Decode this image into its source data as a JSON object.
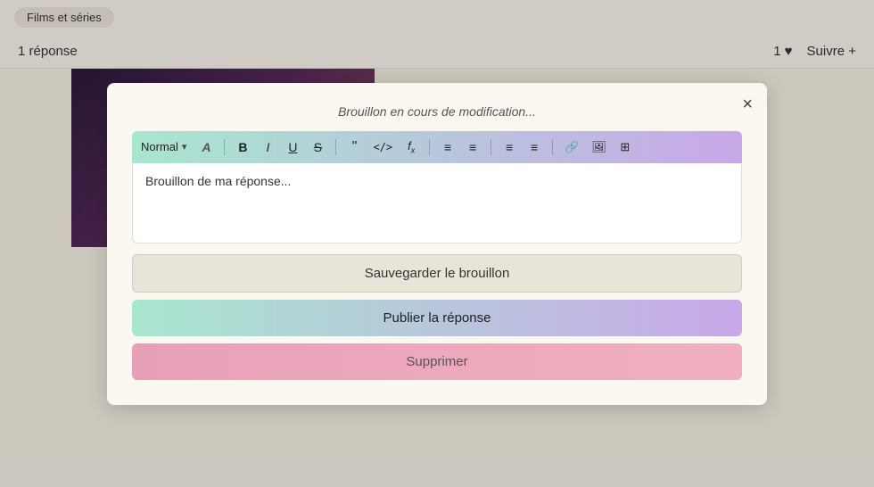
{
  "page": {
    "tag": "Films et séries",
    "replies_count": "1 réponse",
    "likes_count": "1",
    "follow_label": "Suivre +",
    "heart_symbol": "♥"
  },
  "modal": {
    "title": "Brouillon en cours de modification...",
    "close_symbol": "×",
    "toolbar": {
      "format_label": "Normal",
      "format_dropdown_arrow": "▾",
      "btn_bold": "B",
      "btn_italic": "I",
      "btn_underline": "U",
      "btn_strikethrough": "S",
      "btn_quote": "❝",
      "btn_code": "</>",
      "btn_formula": "ƒx",
      "btn_ol": "≡",
      "btn_ul": "≡",
      "btn_align_left": "≡",
      "btn_align_right": "≡",
      "btn_link": "🔗",
      "btn_image": "🖼",
      "btn_table": "⊞"
    },
    "editor_content": "Brouillon de ma réponse...",
    "btn_save_label": "Sauvegarder le brouillon",
    "btn_publish_label": "Publier la réponse",
    "btn_delete_label": "Supprimer"
  }
}
